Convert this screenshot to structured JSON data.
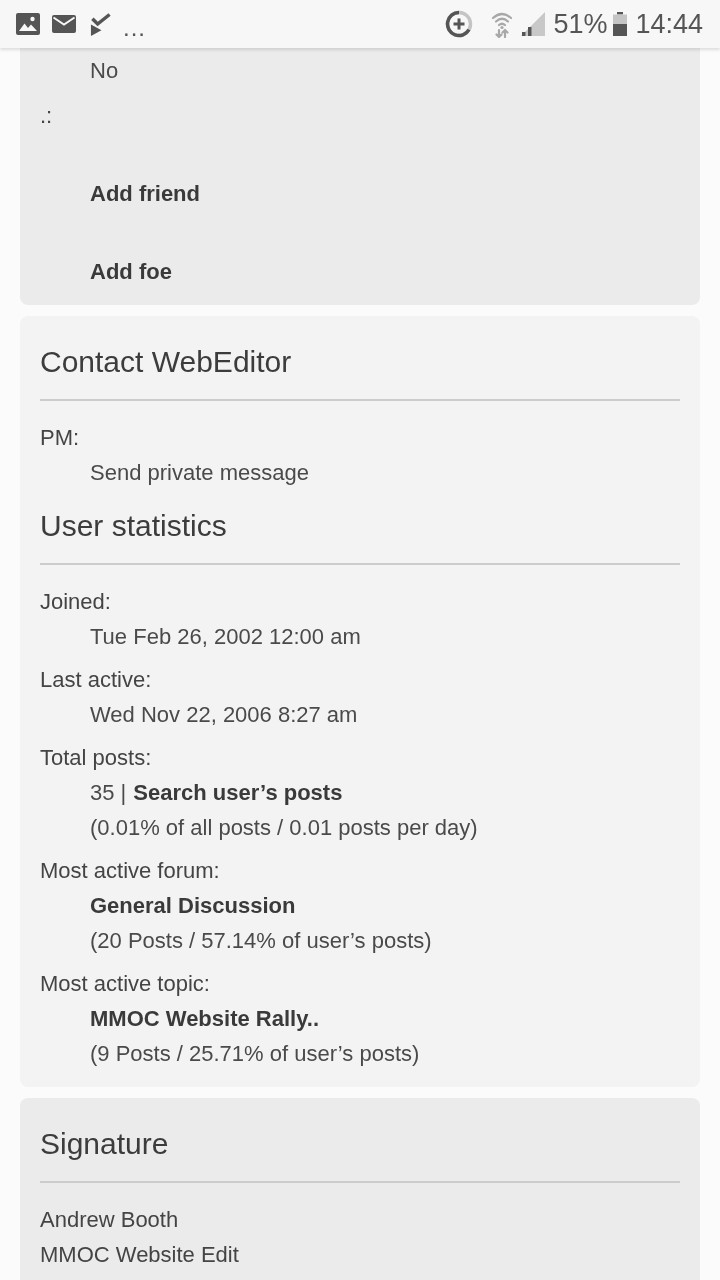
{
  "status_bar": {
    "more": "...",
    "battery": "51%",
    "time": "14:44"
  },
  "cards": [
    {
      "kind": "plain",
      "color": "#ebebeb",
      "sections": [
        {
          "lines": [
            {
              "kind": "value",
              "parts": [
                {
                  "kind": "text",
                  "text": "No"
                }
              ]
            },
            {
              "kind": "label",
              "text": ".:"
            },
            {
              "kind": "value",
              "parts": [
                {
                  "kind": "link",
                  "text": "Add friend"
                }
              ]
            },
            {
              "kind": "value",
              "parts": [
                {
                  "kind": "link",
                  "text": "Add foe"
                }
              ]
            }
          ]
        }
      ]
    },
    {
      "kind": "titled",
      "color": "#f3f3f3",
      "sections": [
        {
          "heading": "Contact WebEditor",
          "lines": [
            {
              "kind": "label",
              "text": "PM:"
            },
            {
              "kind": "value",
              "parts": [
                {
                  "kind": "plain_link",
                  "text": "Send private message"
                }
              ]
            }
          ]
        },
        {
          "heading": "User statistics",
          "lines": [
            {
              "kind": "label",
              "text": "Joined:"
            },
            {
              "kind": "value",
              "parts": [
                {
                  "kind": "text",
                  "text": "Tue Feb 26, 2002 12:00 am"
                }
              ]
            },
            {
              "kind": "label",
              "text": "Last active:"
            },
            {
              "kind": "value",
              "parts": [
                {
                  "kind": "text",
                  "text": "Wed Nov 22, 2006 8:27 am"
                }
              ]
            },
            {
              "kind": "label",
              "text": "Total posts:"
            },
            {
              "kind": "value",
              "parts": [
                {
                  "kind": "text",
                  "text": "35 |"
                },
                {
                  "kind": "link",
                  "text": "Search user’s posts"
                }
              ]
            },
            {
              "kind": "value",
              "parts": [
                {
                  "kind": "text",
                  "text": "(0.01% of all posts / 0.01 posts per day)"
                }
              ]
            },
            {
              "kind": "label",
              "text": "Most active forum:"
            },
            {
              "kind": "value",
              "parts": [
                {
                  "kind": "link",
                  "text": "General Discussion"
                }
              ]
            },
            {
              "kind": "value",
              "parts": [
                {
                  "kind": "text",
                  "text": "(20 Posts / 57.14% of user’s posts)"
                }
              ]
            },
            {
              "kind": "label",
              "text": "Most active topic:"
            },
            {
              "kind": "value",
              "parts": [
                {
                  "kind": "link",
                  "text": "MMOC Website Rally.."
                }
              ]
            },
            {
              "kind": "value",
              "parts": [
                {
                  "kind": "text",
                  "text": "(9 Posts / 25.71% of user’s posts)"
                }
              ]
            }
          ]
        }
      ]
    },
    {
      "kind": "titled",
      "color": "#ebebeb",
      "sections": [
        {
          "heading": "Signature",
          "lines": [
            {
              "kind": "text",
              "text": "Andrew Booth"
            },
            {
              "kind": "text",
              "text": "MMOC Website Edit"
            }
          ]
        }
      ]
    }
  ]
}
